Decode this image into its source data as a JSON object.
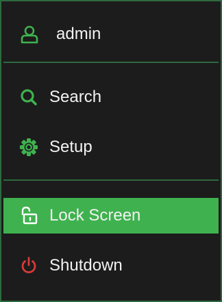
{
  "user": {
    "name": "admin",
    "icon": "user-icon"
  },
  "menu": {
    "items": [
      {
        "label": "Search",
        "icon": "search-icon"
      },
      {
        "label": "Setup",
        "icon": "gear-icon"
      },
      {
        "label": "Lock Screen",
        "icon": "unlock-icon"
      },
      {
        "label": "Shutdown",
        "icon": "power-icon"
      }
    ]
  },
  "colors": {
    "accent": "#3fb24f",
    "border": "#2e6a3f",
    "background": "#1c1c1c",
    "power": "#d93a3a",
    "text": "#f2f2f2"
  }
}
